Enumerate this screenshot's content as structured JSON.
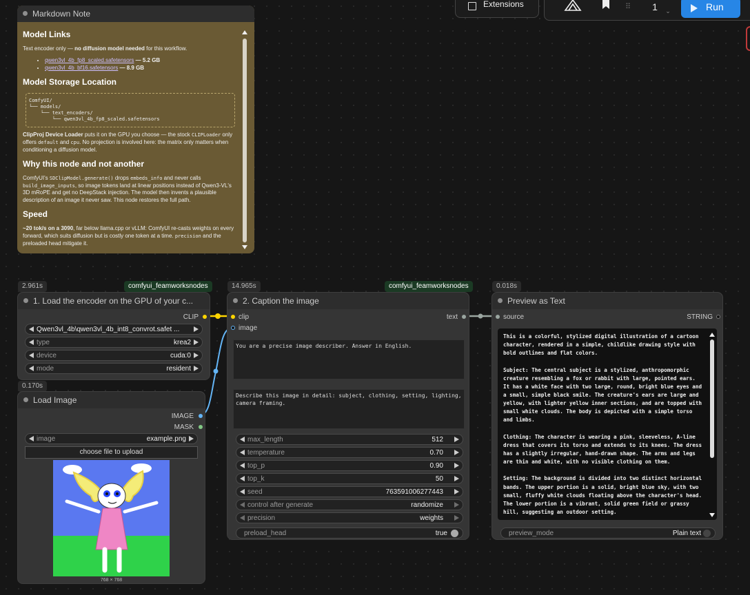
{
  "toolbar": {
    "extensions_label": "Extensions",
    "queue_count": "1",
    "run_label": "Run"
  },
  "note": {
    "title": "Markdown Note",
    "h_links": "Model Links",
    "p_links_pre": "Text encoder only — ",
    "p_links_bold": "no diffusion model needed",
    "p_links_post": " for this workflow.",
    "link1": "qwen3vl_4b_fp8_scaled.safetensors",
    "link1_size": " — 5.2 GB",
    "link2": "qwen3vl_4b_bf16.safetensors",
    "link2_size": " — 8.9 GB",
    "h_storage": "Model Storage Location",
    "tree": "ComfyUI/\n└── models/\n    └── text_encoders/\n        └── qwen3vl_4b_fp8_scaled.safetensors",
    "p_device_bold": "ClipProj Device Loader",
    "p_device_a": " puts it on the GPU you choose — the stock ",
    "p_device_code1": "CLIPLoader",
    "p_device_b": " only offers ",
    "p_device_code2": "default",
    "p_device_c": " and ",
    "p_device_code3": "cpu",
    "p_device_d": ". No projection is involved here: the matrix only matters when conditioning a diffusion model.",
    "h_why": "Why this node and not another",
    "p_why_a": "ComfyUI's ",
    "p_why_code1": "SDClipModel.generate()",
    "p_why_b": " drops ",
    "p_why_code2": "embeds_info",
    "p_why_c": " and never calls ",
    "p_why_code3": "build_image_inputs",
    "p_why_d": ", so image tokens land at linear positions instead of Qwen3-VL's 3D mRoPE and get no DeepStack injection. The model then invents a plausible description of an image it never saw. This node restores the full path.",
    "h_speed": "Speed",
    "p_speed_bold": "~20 tok/s on a 3090",
    "p_speed_a": ", far below llama.cpp or vLLM: ComfyUI re-casts weights on every forward, which suits diffusion but is costly one token at a time. ",
    "p_speed_code": "precision",
    "p_speed_b": " and the preloaded head mitigate it."
  },
  "node1": {
    "time": "2.961s",
    "pack": "comfyui_feamworksnodes",
    "title": "1. Load the encoder on the GPU of your c...",
    "output": "CLIP",
    "model": "Qwen3vl_4b\\qwen3vl_4b_int8_convrot.safet ...",
    "type_label": "type",
    "type_value": "krea2",
    "device_label": "device",
    "device_value": "cuda:0",
    "mode_label": "mode",
    "mode_value": "resident"
  },
  "node_load": {
    "time": "0.170s",
    "title": "Load Image",
    "out_image": "IMAGE",
    "out_mask": "MASK",
    "image_label": "image",
    "image_value": "example.png",
    "upload_label": "choose file to upload",
    "dims": "768 × 768"
  },
  "node2": {
    "time": "14.965s",
    "pack": "comfyui_feamworksnodes",
    "title": "2. Caption the image",
    "in_clip": "clip",
    "in_image": "image",
    "out_text": "text",
    "system_prompt": "You are a precise image describer. Answer in English.",
    "user_prompt": "Describe this image in detail: subject, clothing, setting, lighting, camera framing.",
    "widgets": [
      {
        "label": "max_length",
        "value": "512"
      },
      {
        "label": "temperature",
        "value": "0.70"
      },
      {
        "label": "top_p",
        "value": "0.90"
      },
      {
        "label": "top_k",
        "value": "50"
      },
      {
        "label": "seed",
        "value": "763591006277443"
      },
      {
        "label": "control after generate",
        "value": "randomize"
      },
      {
        "label": "precision",
        "value": "weights"
      }
    ],
    "preload_label": "preload_head",
    "preload_value": "true"
  },
  "node3": {
    "time": "0.018s",
    "title": "Preview as Text",
    "in_source": "source",
    "out_string": "STRING",
    "text": "This is a colorful, stylized digital illustration of a cartoon character, rendered in a simple, childlike drawing style with bold outlines and flat colors.\n\nSubject: The central subject is a stylized, anthropomorphic creature resembling a fox or rabbit with large, pointed ears. It has a white face with two large, round, bright blue eyes and a small, simple black smile. The creature's ears are large and yellow, with lighter yellow inner sections, and are topped with small white clouds. The body is depicted with a simple torso and limbs.\n\nClothing: The character is wearing a pink, sleeveless, A-line dress that covers its torso and extends to its knees. The dress has a slightly irregular, hand-drawn shape. The arms and legs are thin and white, with no visible clothing on them.\n\nSetting: The background is divided into two distinct horizontal bands. The upper portion is a solid, bright blue sky, with two small, fluffy white clouds floating above the character's head. The lower portion is a vibrant, solid green field or grassy hill, suggesting an outdoor setting.",
    "mode_label": "preview_mode",
    "mode_value": "Plain text"
  },
  "colors": {
    "clip_wire": "#ffd500",
    "image_wire": "#64b5f6",
    "string_wire": "#9aa5a0",
    "run": "#2786e6",
    "note_bg": "#6a5a34"
  }
}
